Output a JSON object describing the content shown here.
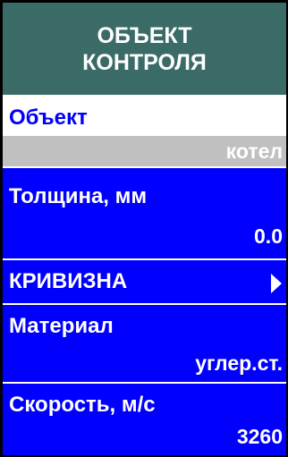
{
  "header": {
    "line1": "ОБЪЕКТ",
    "line2": "КОНТРОЛЯ"
  },
  "menu": {
    "object": {
      "label": "Объект",
      "value": "котел"
    },
    "thickness": {
      "label": "Толщина, мм",
      "value": "0.0"
    },
    "curvature": {
      "label": "КРИВИЗНА",
      "icon": "submenu-arrow-icon"
    },
    "material": {
      "label": "Материал",
      "value": "углер.ст."
    },
    "speed": {
      "label": "Скорость, м/с",
      "value": "3260"
    }
  },
  "colors": {
    "header_bg": "#3a6b67",
    "item_bg": "#0000fc",
    "selected_value_bg": "#c0c0c0"
  }
}
